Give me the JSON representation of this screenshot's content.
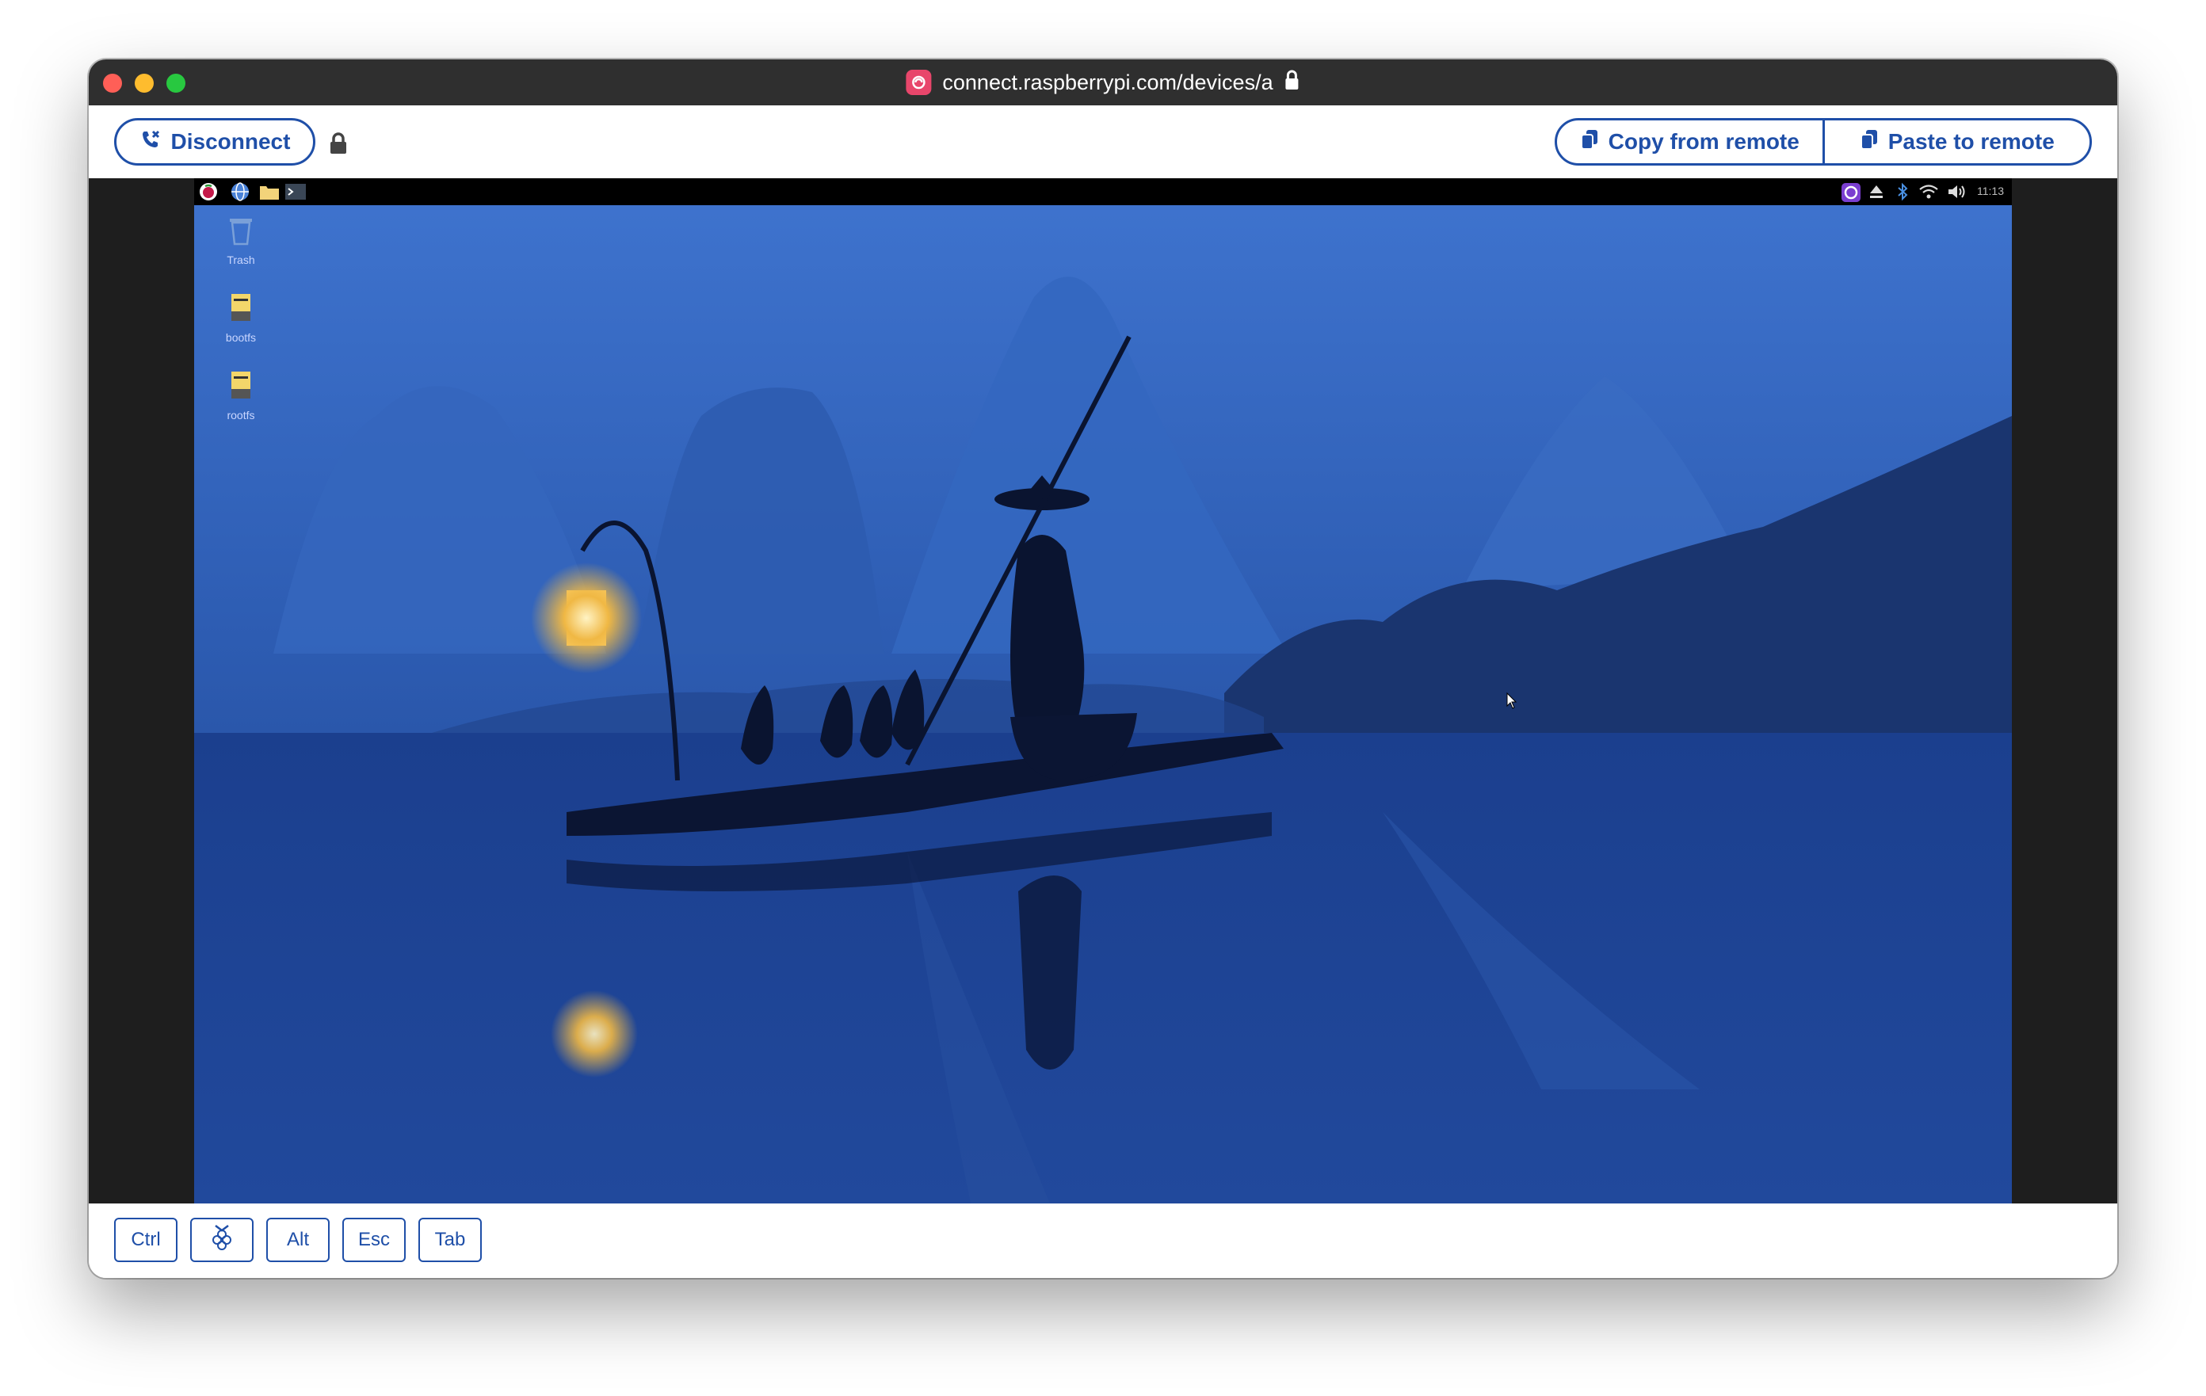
{
  "window": {
    "url": "connect.raspberrypi.com/devices/a"
  },
  "toolbar": {
    "disconnect_label": "Disconnect",
    "copy_label": "Copy from remote",
    "paste_label": "Paste to remote"
  },
  "remote_desktop": {
    "clock": "11:13",
    "icons": [
      {
        "label": "Trash"
      },
      {
        "label": "bootfs"
      },
      {
        "label": "rootfs"
      }
    ]
  },
  "keys": {
    "ctrl": "Ctrl",
    "alt": "Alt",
    "esc": "Esc",
    "tab": "Tab"
  },
  "colors": {
    "accent": "#1f4fa8",
    "titlebar": "#2f2f2f",
    "wallpaper_blue": "#2f5db0"
  }
}
